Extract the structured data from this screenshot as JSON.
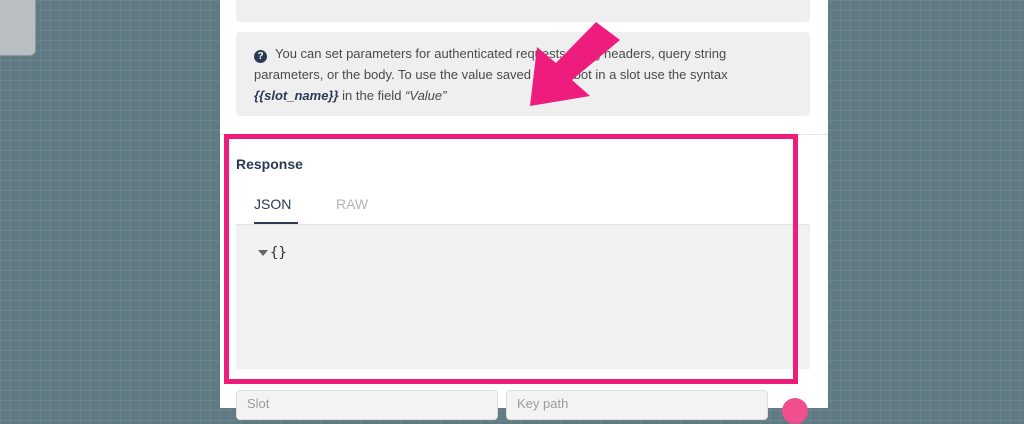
{
  "info": {
    "icon": "help-circle-icon",
    "text_before": "You can set parameters for authenticated requests using headers, query string parameters, or the body. To use the value saved by the bot in a slot use the syntax ",
    "slot_syntax": "{{slot_name}}",
    "text_middle": " in the field ",
    "field_name": "“Value”"
  },
  "response": {
    "title": "Response",
    "tabs": [
      {
        "label": "JSON",
        "active": true
      },
      {
        "label": "RAW",
        "active": false
      }
    ],
    "json_preview": "{}"
  },
  "bottom_fields": [
    {
      "placeholder": "Slot"
    },
    {
      "placeholder": "Key path"
    }
  ],
  "colors": {
    "annotation": "#ee1d7d",
    "accent": "#2b3a55",
    "background": "#5f7a83"
  }
}
